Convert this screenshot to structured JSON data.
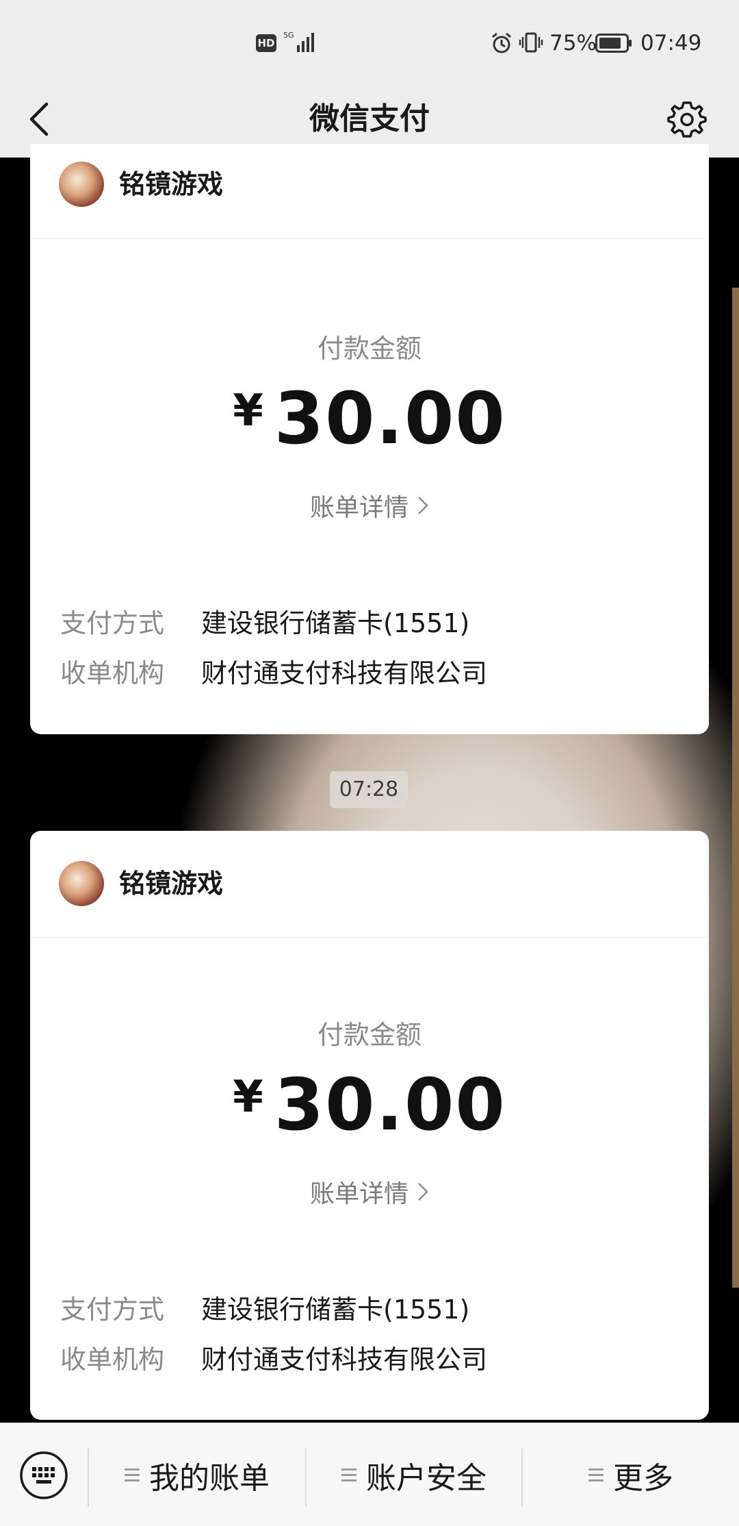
{
  "status_bar": {
    "hd_badge": "HD",
    "network": "5G",
    "battery_percent": "75%",
    "time": "07:49",
    "icons": [
      "hd-icon",
      "signal-icon",
      "alarm-icon",
      "vibrate-icon",
      "battery-icon"
    ]
  },
  "nav": {
    "title": "微信支付",
    "back_icon": "chevron-left-icon",
    "settings_icon": "gear-icon"
  },
  "messages": [
    {
      "merchant": "铭镜游戏",
      "amount_label": "付款金额",
      "currency": "¥",
      "amount": "30.00",
      "detail_link": "账单详情",
      "rows": [
        {
          "key": "支付方式",
          "value": "建设银行储蓄卡(1551)"
        },
        {
          "key": "收单机构",
          "value": "财付通支付科技有限公司"
        }
      ]
    },
    {
      "merchant": "铭镜游戏",
      "amount_label": "付款金额",
      "currency": "¥",
      "amount": "30.00",
      "detail_link": "账单详情",
      "rows": [
        {
          "key": "支付方式",
          "value": "建设银行储蓄卡(1551)"
        },
        {
          "key": "收单机构",
          "value": "财付通支付科技有限公司"
        }
      ]
    }
  ],
  "timestamp": "07:28",
  "bottom_menu": {
    "keyboard_icon": "keyboard-icon",
    "items": [
      "我的账单",
      "账户安全",
      "更多"
    ]
  }
}
